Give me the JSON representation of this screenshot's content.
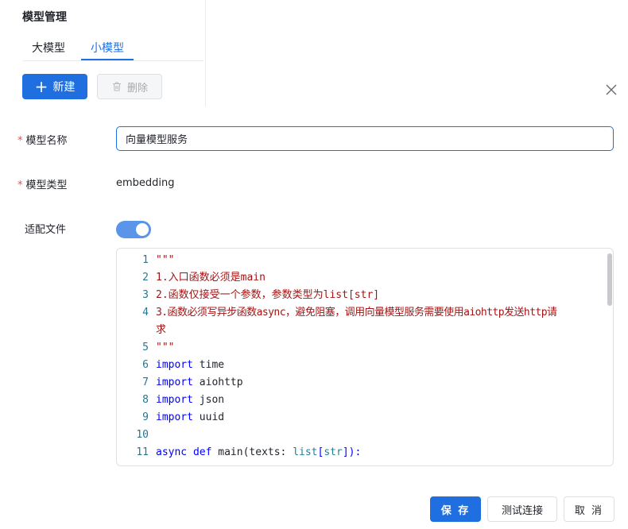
{
  "page": {
    "title": "模型管理"
  },
  "tabs": [
    {
      "label": "大模型",
      "active": false
    },
    {
      "label": "小模型",
      "active": true
    }
  ],
  "toolbar": {
    "new_label": "新建",
    "delete_label": "删除"
  },
  "form": {
    "name_label": "模型名称",
    "name_value": "向量模型服务",
    "type_label": "模型类型",
    "type_value": "embedding",
    "file_label": "适配文件",
    "file_enabled": true
  },
  "editor": {
    "lines": [
      {
        "no": "1",
        "text": "\"\"\""
      },
      {
        "no": "2",
        "text": "1.入口函数必须是main"
      },
      {
        "no": "3",
        "text": "2.函数仅接受一个参数，参数类型为list[str]"
      },
      {
        "no": "4",
        "text": "3.函数必须写异步函数async，避免阻塞，调用向量模型服务需要使用aiohttp发送http请"
      },
      {
        "no": "",
        "text": "求"
      },
      {
        "no": "5",
        "text": "\"\"\""
      },
      {
        "no": "6",
        "kw": "import",
        "rest": " time"
      },
      {
        "no": "7",
        "kw": "import",
        "rest": " aiohttp"
      },
      {
        "no": "8",
        "kw": "import",
        "rest": " json"
      },
      {
        "no": "9",
        "kw": "import",
        "rest": " uuid"
      },
      {
        "no": "10",
        "text": ""
      },
      {
        "no": "11",
        "kw1": "async",
        "kw2": "def",
        "fn": " main(texts: ",
        "ty1": "list",
        "b1": "[",
        "ty2": "str",
        "b2": "]):"
      }
    ]
  },
  "footer": {
    "save_label": "保 存",
    "test_label": "测试连接",
    "cancel_label": "取 消"
  },
  "colors": {
    "primary": "#1f6fe0",
    "required": "#f54a45",
    "string": "#a31515",
    "keyword": "#0000ff",
    "line_number": "#237893"
  }
}
